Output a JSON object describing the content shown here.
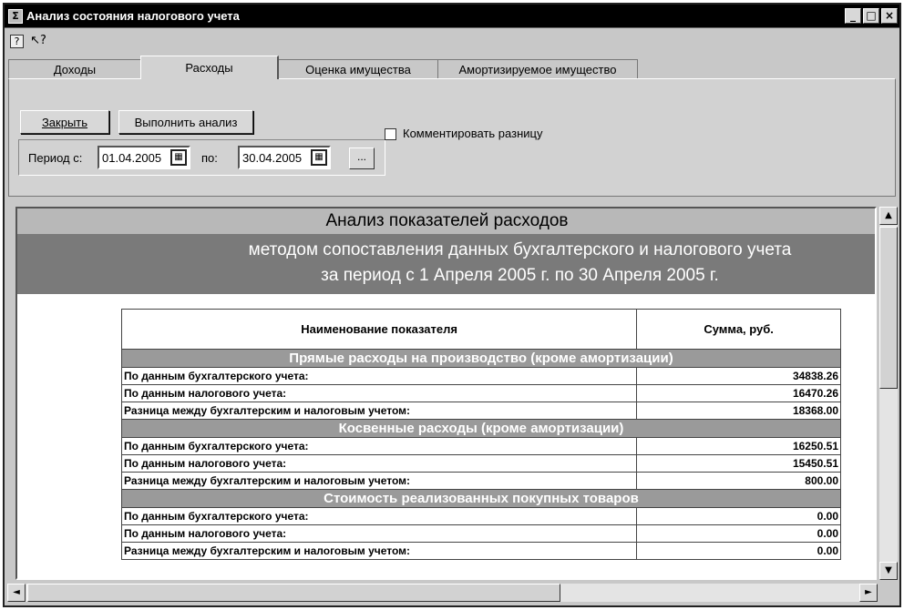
{
  "window": {
    "title": "Анализ состояния налогового учета",
    "controls": [
      "_",
      "□",
      "×"
    ]
  },
  "toolbar": {
    "help_icon": "?",
    "whatsthis_icon": "↖?"
  },
  "tabs": [
    {
      "label": "Доходы"
    },
    {
      "label": "Расходы"
    },
    {
      "label": "Оценка имущества"
    },
    {
      "label": "Амортизируемое имущество"
    }
  ],
  "panel": {
    "close_button": "Закрыть",
    "analyze_button": "Выполнить анализ",
    "period_label": "Период с:",
    "date_from": "01.04.2005",
    "to_label": "по:",
    "date_to": "30.04.2005",
    "dots_button": "...",
    "comment_checkbox_label": "Комментировать разницу",
    "comment_checked": false
  },
  "report": {
    "title": "Анализ показателей расходов",
    "subtitle_1": "методом сопоставления данных бухгалтерского и налогового учета",
    "subtitle_2": "за  период с 1 Апреля 2005 г. по 30 Апреля 2005 г.",
    "col_name": "Наименование показателя",
    "col_sum": "Сумма, руб.",
    "sections": [
      {
        "title": "Прямые расходы на производство (кроме амортизации)",
        "rows": [
          {
            "name": "По данным бухгалтерского учета:",
            "value": "34838.26"
          },
          {
            "name": "По данным налогового учета:",
            "value": "16470.26"
          },
          {
            "name": "Разница между бухгалтерским и налоговым учетом:",
            "value": "18368.00"
          }
        ]
      },
      {
        "title": "Косвенные расходы (кроме амортизации)",
        "rows": [
          {
            "name": "По данным бухгалтерского учета:",
            "value": "16250.51"
          },
          {
            "name": "По данным налогового учета:",
            "value": "15450.51"
          },
          {
            "name": "Разница между бухгалтерским и налоговым учетом:",
            "value": "800.00"
          }
        ]
      },
      {
        "title": "Стоимость реализованных покупных товаров",
        "rows": [
          {
            "name": "По данным бухгалтерского учета:",
            "value": "0.00"
          },
          {
            "name": "По данным налогового учета:",
            "value": "0.00"
          },
          {
            "name": "Разница между бухгалтерским и налоговым учетом:",
            "value": "0.00"
          }
        ]
      }
    ]
  },
  "scrollbars": {
    "up": "▲",
    "down": "▼",
    "left": "◄",
    "right": "►"
  }
}
